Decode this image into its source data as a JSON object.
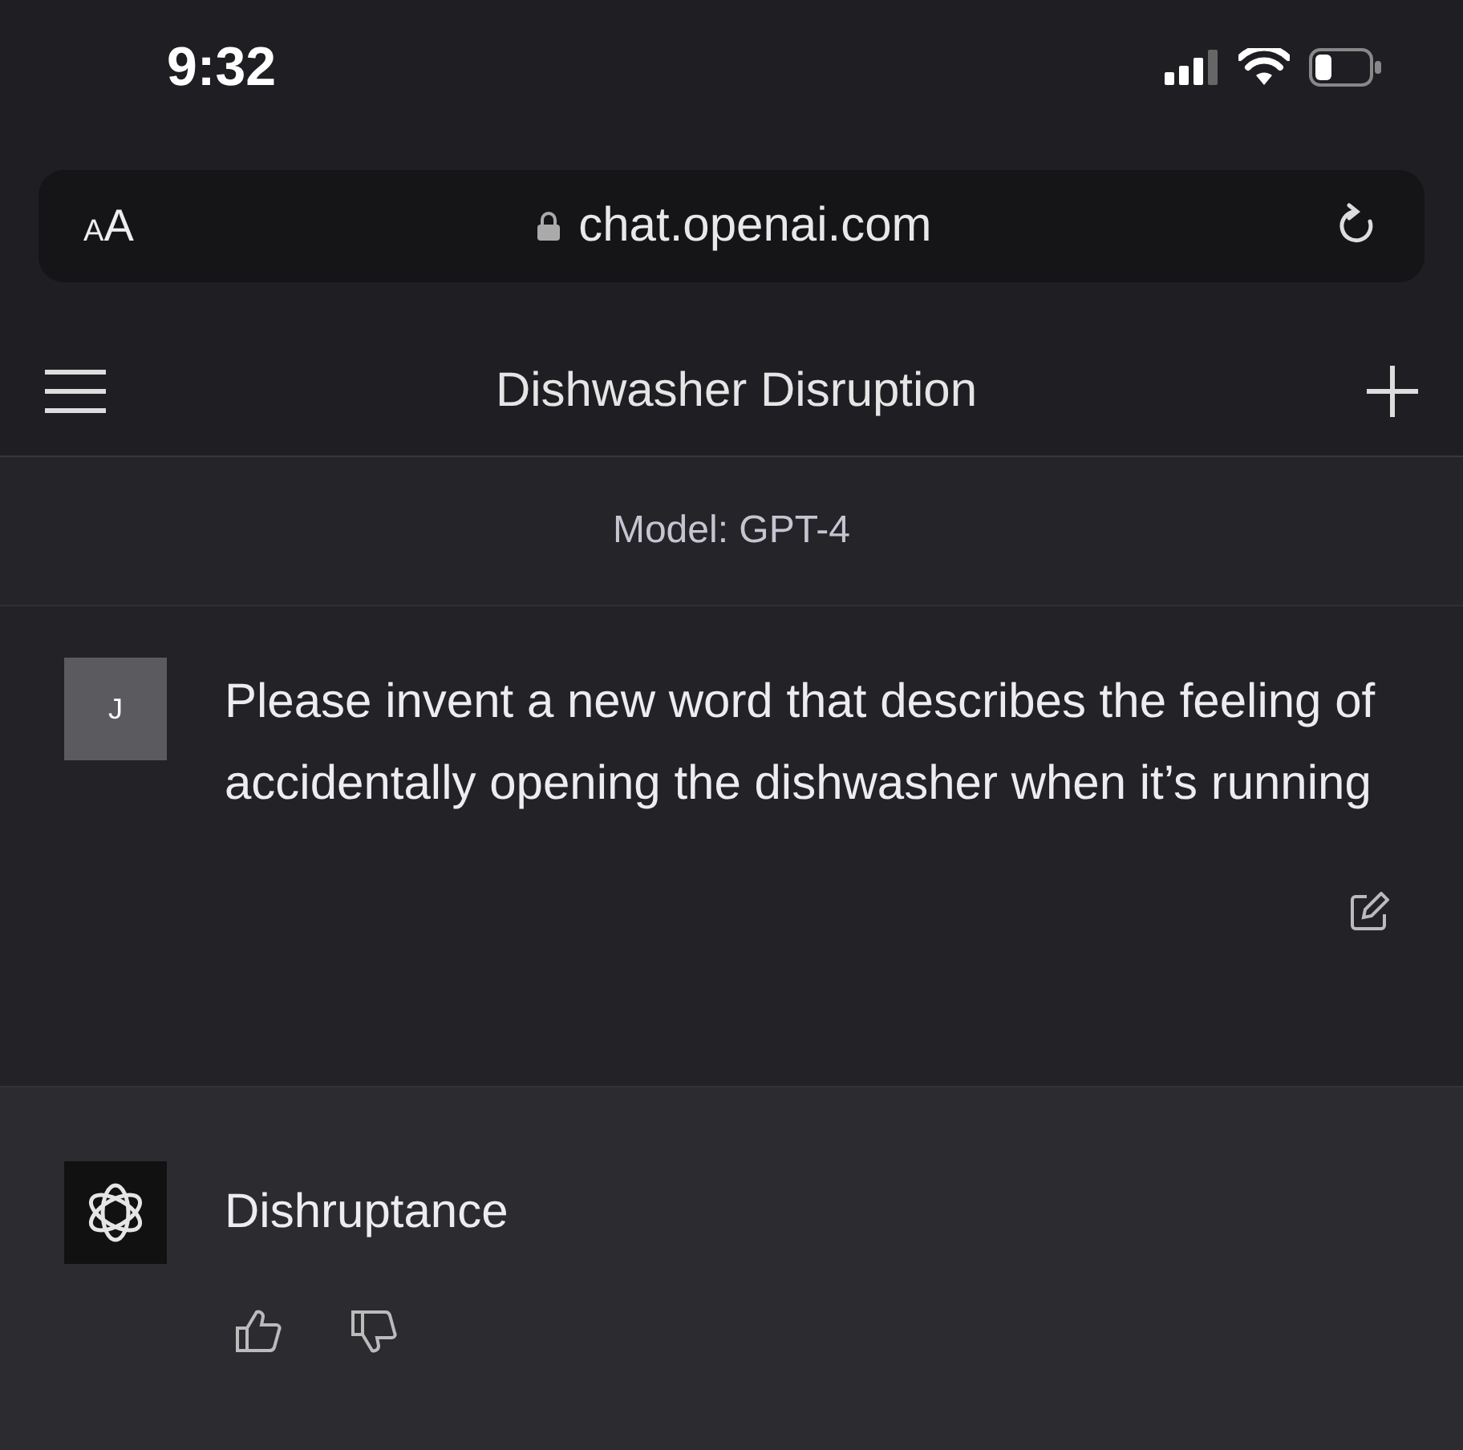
{
  "status_bar": {
    "time": "9:32"
  },
  "address_bar": {
    "text_size_button": "AA",
    "url": "chat.openai.com"
  },
  "header": {
    "title": "Dishwasher Disruption"
  },
  "model_label": "Model: GPT-4",
  "messages": [
    {
      "kind": "user",
      "avatar": "J",
      "text": "Please invent a new word that describes the feeling of accidentally opening the dishwasher when it’s running"
    },
    {
      "kind": "assistant",
      "text": "Dishruptance"
    }
  ]
}
